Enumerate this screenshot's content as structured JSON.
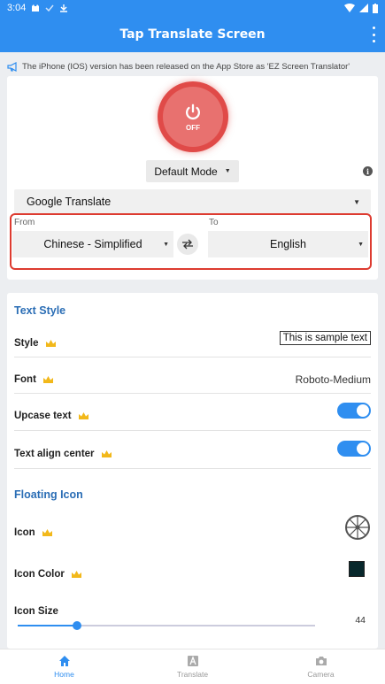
{
  "status_bar": {
    "time": "3:04",
    "icons": [
      "cat-icon",
      "check-icon",
      "download-icon",
      "wifi-icon",
      "signal-icon",
      "battery-icon"
    ]
  },
  "app_bar": {
    "title": "Tap Translate Screen",
    "menu_icon": "more-vertical-icon"
  },
  "notice": {
    "text": "The iPhone (IOS) version has been released on the App Store as 'EZ Screen Translator'",
    "icon": "megaphone-icon"
  },
  "power": {
    "label": "OFF",
    "color": "#e04a48",
    "icon": "power-icon"
  },
  "mode": {
    "selected": "Default Mode"
  },
  "engine": {
    "selected": "Google Translate"
  },
  "languages": {
    "from_label": "From",
    "from_value": "Chinese - Simplified",
    "to_label": "To",
    "to_value": "English",
    "highlight_color": "#dd3b30"
  },
  "text_style": {
    "title": "Text Style",
    "style_label": "Style",
    "style_sample": "This is sample text",
    "font_label": "Font",
    "font_value": "Roboto-Medium",
    "upcase_label": "Upcase text",
    "upcase_on": true,
    "align_label": "Text align center",
    "align_on": true
  },
  "floating_icon": {
    "title": "Floating Icon",
    "icon_label": "Icon",
    "icon_value": "wheel-icon",
    "color_label": "Icon Color",
    "color_value": "#08282c",
    "size_label": "Icon Size",
    "size_value": "44",
    "size_fraction": 0.2
  },
  "bottom_nav": {
    "items": [
      {
        "label": "Home",
        "icon": "home-icon",
        "active": true
      },
      {
        "label": "Translate",
        "icon": "translate-icon",
        "active": false
      },
      {
        "label": "Camera",
        "icon": "camera-icon",
        "active": false
      }
    ]
  },
  "colors": {
    "primary": "#2f8ef0",
    "section_title": "#2a6db5",
    "crown": "#f2b81a"
  }
}
